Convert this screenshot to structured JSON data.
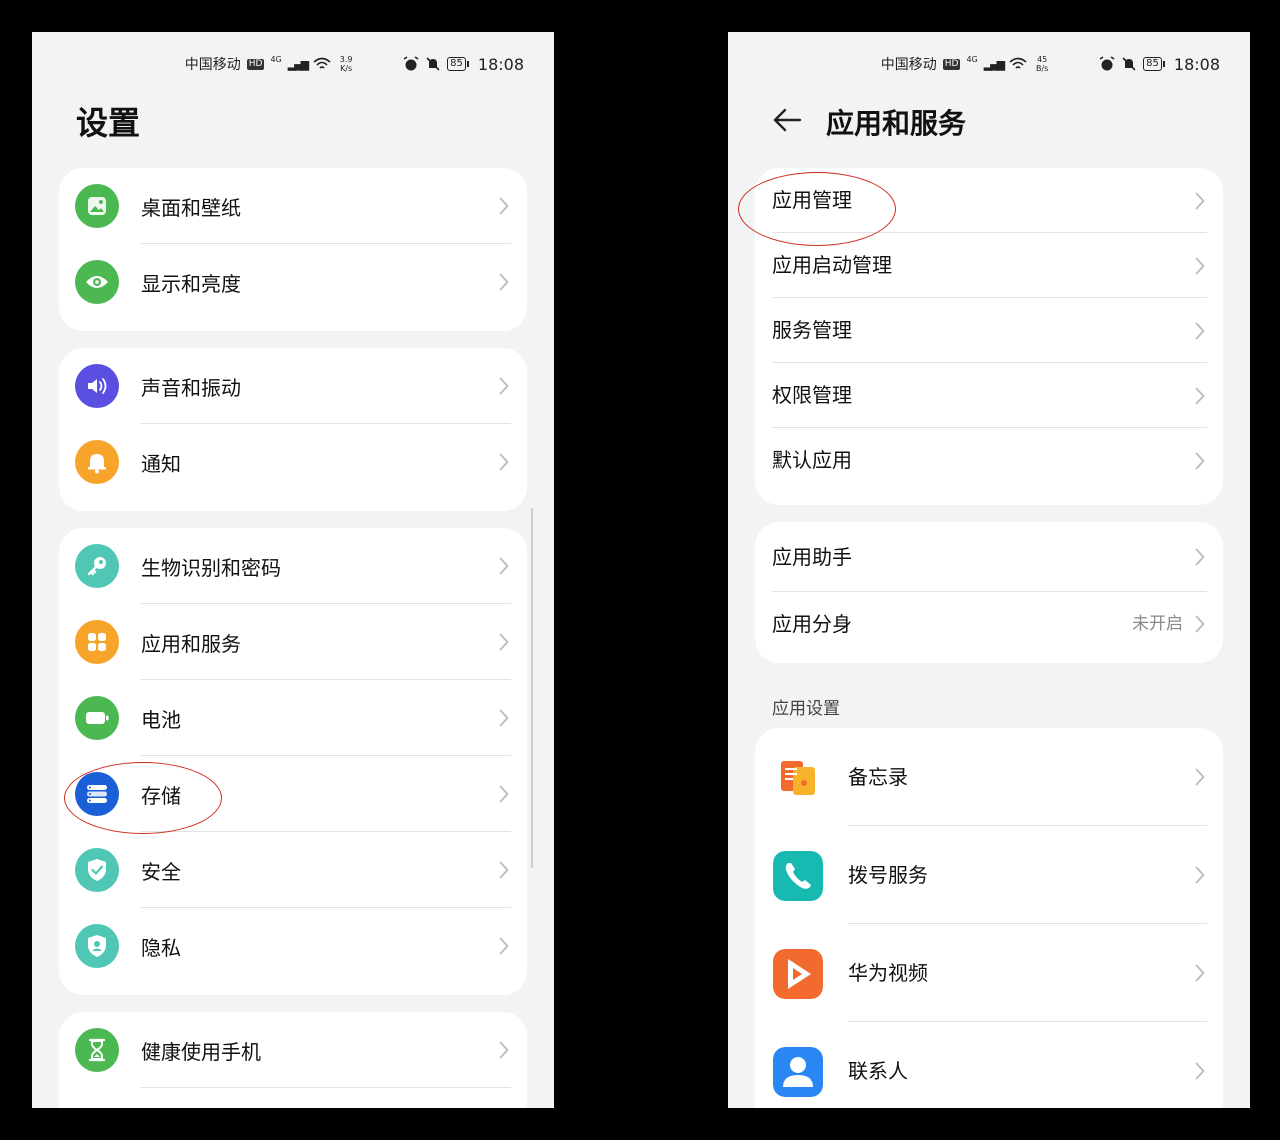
{
  "left": {
    "status": {
      "carrier": "中国移动",
      "hd": "HD",
      "net": "4G",
      "speed_top": "3.9",
      "speed_bottom": "K/s",
      "battery": "85",
      "time": "18:08"
    },
    "title": "设置",
    "groups": [
      {
        "items": [
          {
            "label": "桌面和壁纸",
            "icon": "wallpaper-icon",
            "color": "#4cb852"
          },
          {
            "label": "显示和亮度",
            "icon": "eye-icon",
            "color": "#4cb852"
          }
        ]
      },
      {
        "items": [
          {
            "label": "声音和振动",
            "icon": "speaker-icon",
            "color": "#5a4fe0"
          },
          {
            "label": "通知",
            "icon": "bell-icon",
            "color": "#f7a52a"
          }
        ]
      },
      {
        "items": [
          {
            "label": "生物识别和密码",
            "icon": "key-icon",
            "color": "#4fc7b4"
          },
          {
            "label": "应用和服务",
            "icon": "apps-grid-icon",
            "color": "#f7a52a"
          },
          {
            "label": "电池",
            "icon": "battery-icon",
            "color": "#4cb852"
          },
          {
            "label": "存储",
            "icon": "storage-icon",
            "color": "#1a5ed8"
          },
          {
            "label": "安全",
            "icon": "shield-check-icon",
            "color": "#4fc7b4"
          },
          {
            "label": "隐私",
            "icon": "privacy-icon",
            "color": "#4fc7b4"
          }
        ]
      },
      {
        "items": [
          {
            "label": "健康使用手机",
            "icon": "hourglass-icon",
            "color": "#4cb852"
          }
        ]
      }
    ]
  },
  "right": {
    "status": {
      "carrier": "中国移动",
      "hd": "HD",
      "net": "4G",
      "speed_top": "45",
      "speed_bottom": "B/s",
      "battery": "85",
      "time": "18:08"
    },
    "title": "应用和服务",
    "group1": [
      {
        "label": "应用管理"
      },
      {
        "label": "应用启动管理"
      },
      {
        "label": "服务管理"
      },
      {
        "label": "权限管理"
      },
      {
        "label": "默认应用"
      }
    ],
    "group2": [
      {
        "label": "应用助手",
        "value": ""
      },
      {
        "label": "应用分身",
        "value": "未开启"
      }
    ],
    "section_label": "应用设置",
    "apps": [
      {
        "label": "备忘录",
        "icon": "notes-app-icon"
      },
      {
        "label": "拨号服务",
        "icon": "phone-app-icon"
      },
      {
        "label": "华为视频",
        "icon": "video-app-icon"
      },
      {
        "label": "联系人",
        "icon": "contacts-app-icon"
      }
    ]
  },
  "accent_colors": {
    "annotation": "#d02a1e",
    "background": "#f1f3f5"
  }
}
